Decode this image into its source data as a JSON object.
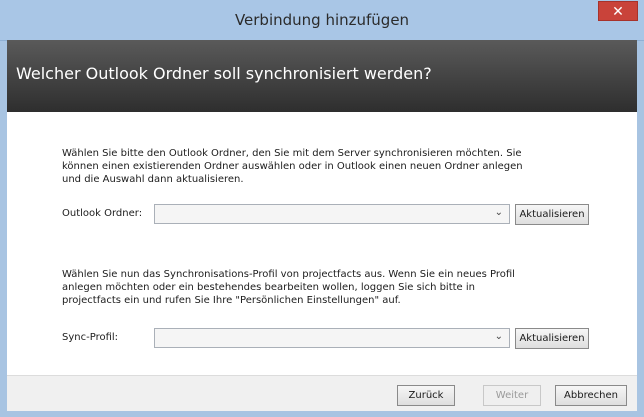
{
  "window": {
    "title": "Verbindung hinzufügen",
    "close_label": "✕"
  },
  "header": {
    "question": "Welcher Outlook Ordner soll synchronisiert werden?"
  },
  "outlook_section": {
    "description_lines": [
      "Wählen Sie bitte den Outlook Ordner, den Sie mit dem Server synchronisieren möchten. Sie",
      "können einen existierenden Ordner auswählen oder in Outlook einen neuen Ordner anlegen",
      "und die Auswahl dann aktualisieren."
    ],
    "label": "Outlook Ordner:",
    "select_value": "",
    "refresh_label": "Aktualisieren"
  },
  "sync_section": {
    "description_lines": [
      "Wählen Sie nun das Synchronisations-Profil von projectfacts aus. Wenn Sie ein neues Profil",
      "anlegen möchten oder ein bestehendes bearbeiten wollen, loggen Sie sich bitte in",
      "projectfacts ein und rufen Sie Ihre \"Persönlichen Einstellungen\" auf."
    ],
    "label": "Sync-Profil:",
    "select_value": "",
    "refresh_label": "Aktualisieren"
  },
  "footer": {
    "back_label": "Zurück",
    "next_label": "Weiter",
    "cancel_label": "Abbrechen"
  },
  "colors": {
    "titlebar": "#a9c6e6",
    "header_band": "#3c3c3c",
    "close_button": "#c9433a"
  }
}
